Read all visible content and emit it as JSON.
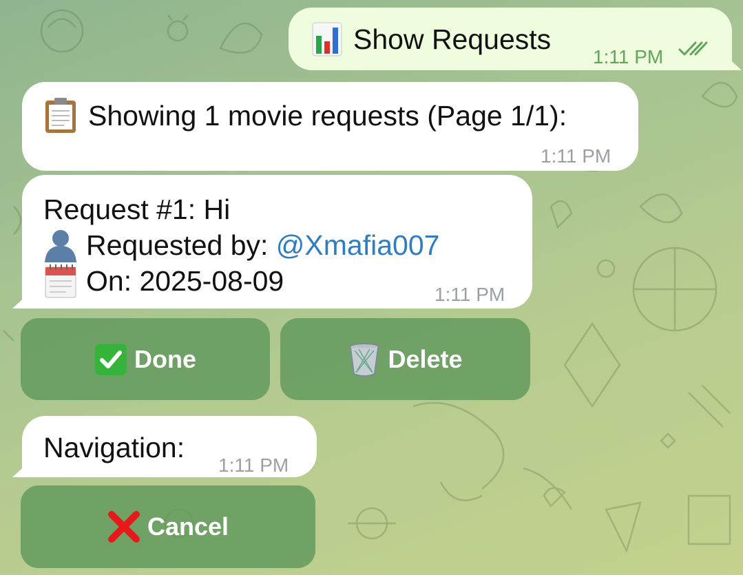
{
  "messages": {
    "outgoing": {
      "icon": "bar-chart-icon",
      "text": "Show Requests",
      "time": "1:11 PM",
      "status": "read-double-check-icon"
    },
    "showing": {
      "icon": "clipboard-icon",
      "text": "Showing 1 movie requests (Page 1/1):",
      "time": "1:11 PM"
    },
    "request": {
      "title": "Request #1: Hi",
      "requested_by_label": "Requested by: ",
      "requested_by_user": "@Xmafia007",
      "on_label": "On: 2025-08-09",
      "time": "1:11 PM",
      "icons": [
        "user-silhouette-icon",
        "calendar-icon"
      ]
    },
    "navigation": {
      "text": "Navigation:",
      "time": "1:11 PM"
    }
  },
  "buttons": {
    "done": {
      "icon": "check-mark-button-icon",
      "label": "Done"
    },
    "delete": {
      "icon": "wastebasket-icon",
      "label": "Delete"
    },
    "cancel": {
      "icon": "cross-mark-icon",
      "label": "Cancel"
    }
  },
  "colors": {
    "outgoing_bubble": "#effdde",
    "incoming_bubble": "#ffffff",
    "link": "#2e7dc0",
    "button_bg": "#5c965a",
    "check_green": "#5fa55a"
  }
}
